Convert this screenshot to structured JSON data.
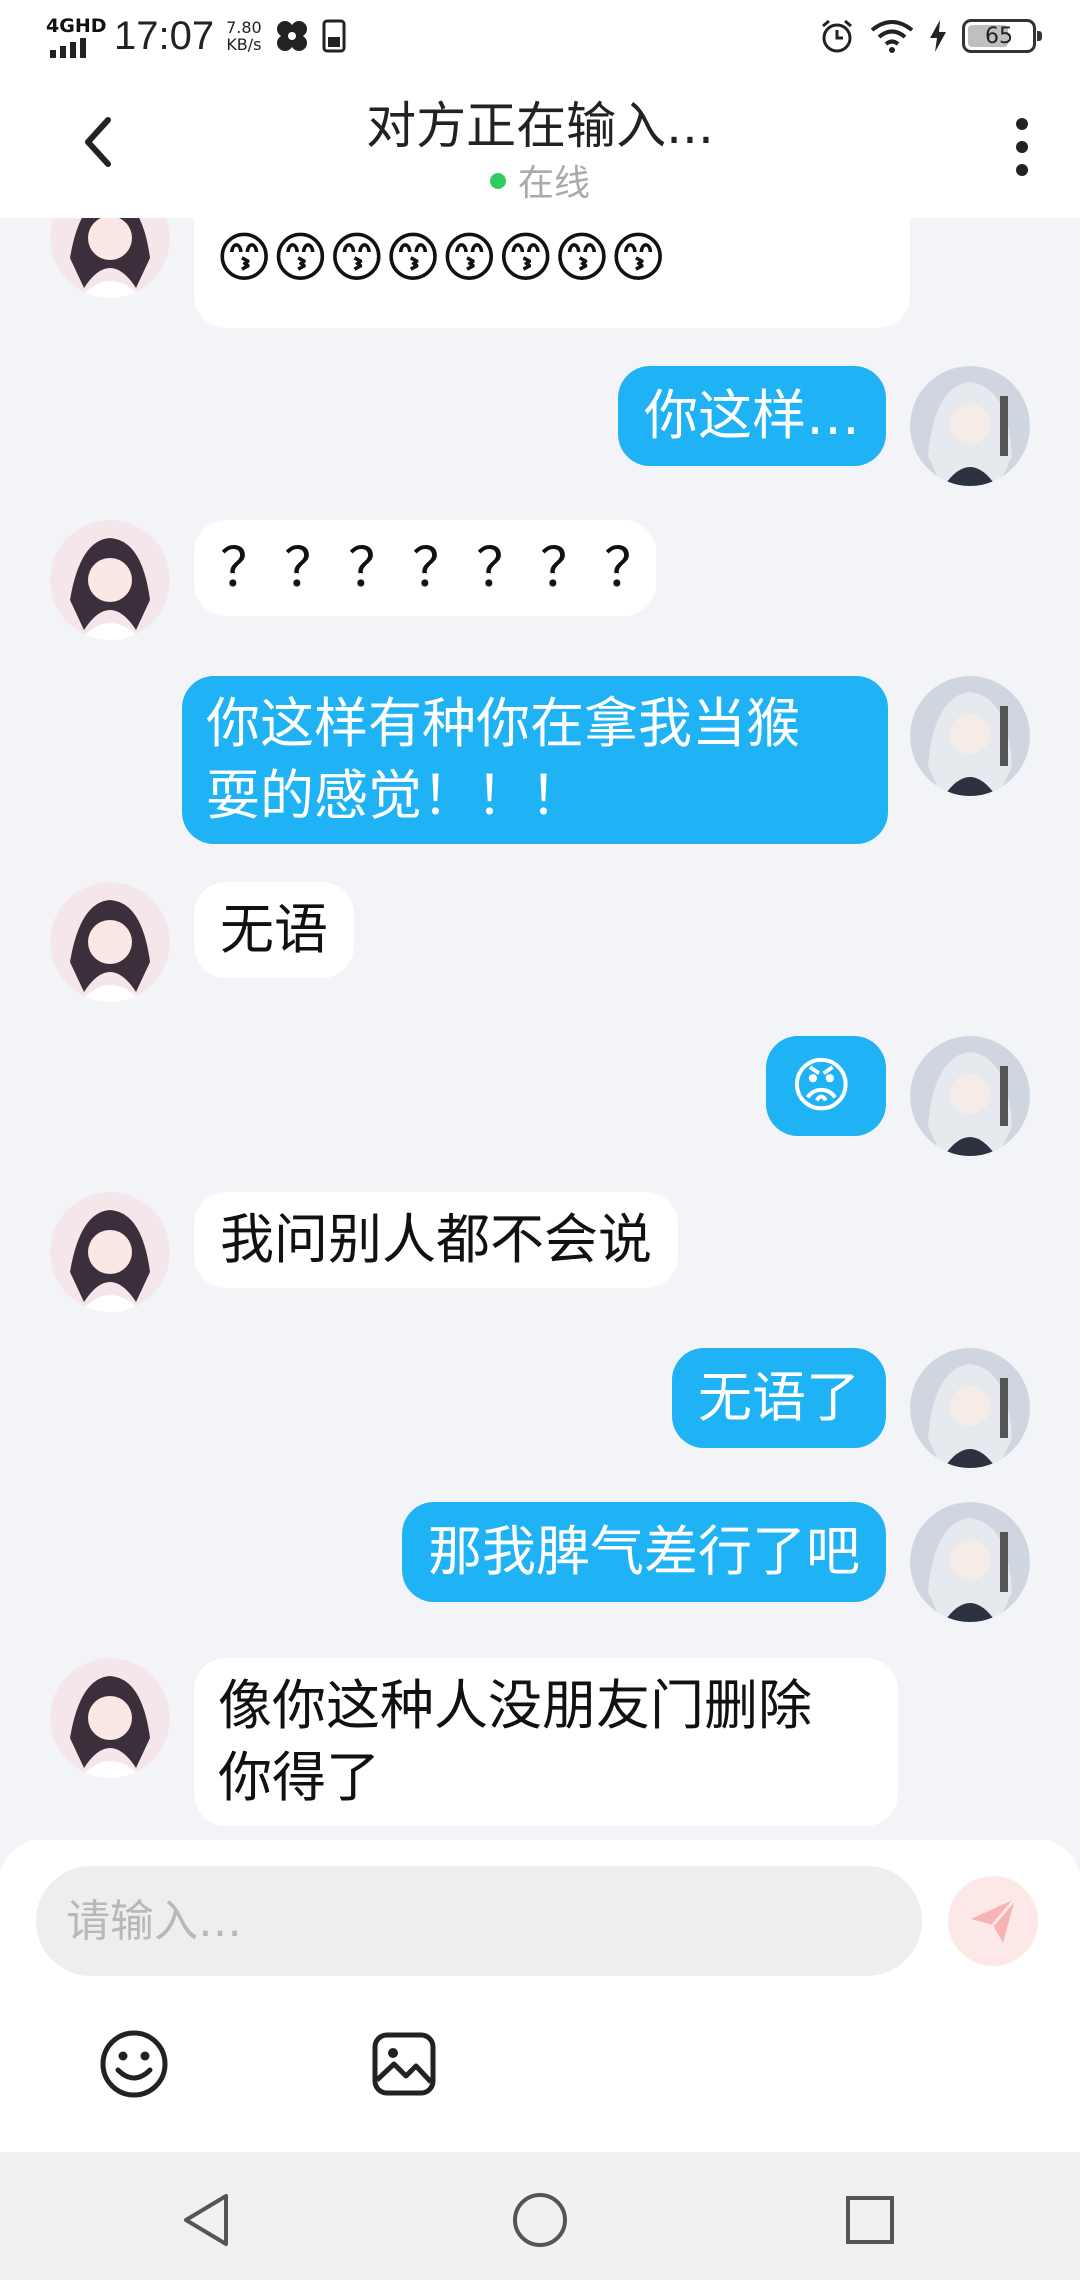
{
  "status_bar": {
    "network": "4GHD",
    "time": "17:07",
    "speed_value": "7.80",
    "speed_unit": "KB/s",
    "battery": "65",
    "battery_level": 0.65
  },
  "header": {
    "title": "对方正在输入...",
    "status": "在线"
  },
  "messages": [
    {
      "side": "in",
      "text": "😙😙😙😙😙😛😛😛😛"
    },
    {
      "side": "in",
      "text": "😙😙😙😙😙😙😙😙"
    },
    {
      "side": "out",
      "text": "你这样…"
    },
    {
      "side": "in",
      "text": "？？？？？？？"
    },
    {
      "side": "out",
      "line1": "你这样有种你在拿我当猴",
      "line2": "耍的感觉！！！"
    },
    {
      "side": "in",
      "text": "无语"
    },
    {
      "side": "out",
      "text": "😡"
    },
    {
      "side": "in",
      "text": "我问别人都不会说"
    },
    {
      "side": "out",
      "text": "无语了"
    },
    {
      "side": "out",
      "text": "那我脾气差行了吧"
    },
    {
      "side": "in",
      "line1": "像你这种人没朋友门删除",
      "line2": "你得了"
    }
  ],
  "composer": {
    "placeholder": "请输入…"
  },
  "icons": {
    "back": "chevron-left-icon",
    "more": "more-vertical-icon",
    "send": "send-icon",
    "emoji": "smiley-icon",
    "image": "image-icon",
    "nav_back": "triangle-back-icon",
    "nav_home": "circle-home-icon",
    "nav_recents": "square-recents-icon"
  },
  "colors": {
    "outgoing_bubble": "#1fb2f4",
    "incoming_bubble": "#ffffff",
    "background": "#f3f4f8",
    "online": "#2ecc5c",
    "send_button": "#fde8e8"
  }
}
